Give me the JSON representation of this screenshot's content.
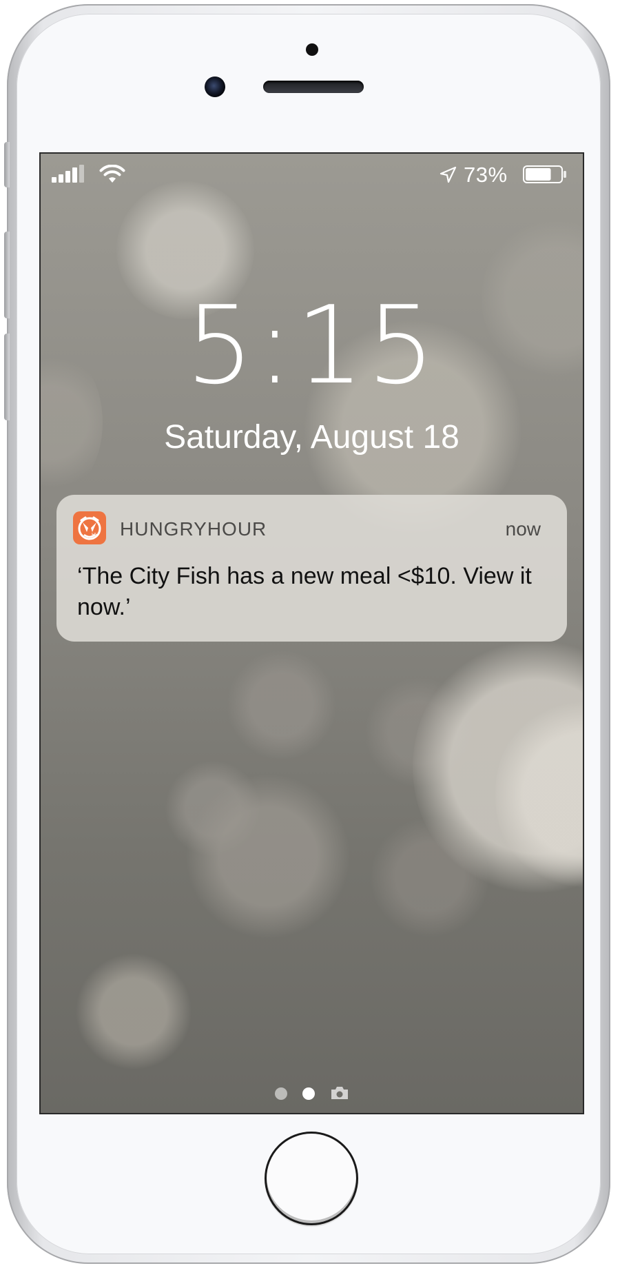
{
  "status_bar": {
    "battery_percent": "73%",
    "battery_level": 0.73,
    "signal_bars": 4
  },
  "lock_screen": {
    "time": "5:15",
    "date": "Saturday, August 18"
  },
  "notification": {
    "app_name": "HUNGRYHOUR",
    "time": "now",
    "message": "‘The City Fish has a new meal <$10. View it now.’",
    "icon": "hungryhour-app-icon",
    "icon_color": "#ee7441"
  },
  "page_indicator": {
    "pages": 2,
    "active_index": 1,
    "trailing_icon": "camera-icon"
  }
}
